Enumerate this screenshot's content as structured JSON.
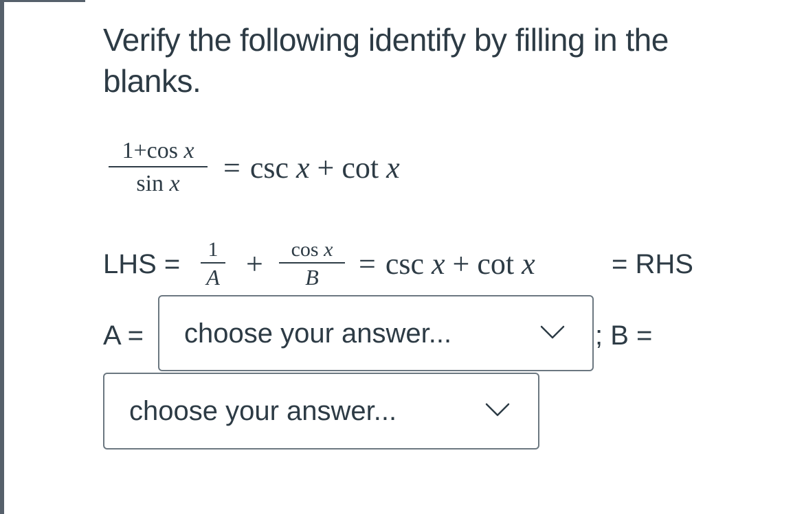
{
  "question": {
    "text": "Verify the following identify by filling in the blanks."
  },
  "identity": {
    "numerator": "1+cos x",
    "denominator": "sin x",
    "equals": "=",
    "rhs": "csc x + cot x"
  },
  "work": {
    "lhs_label": "LHS =",
    "frac1_num": "1",
    "frac1_den": "A",
    "plus": "+",
    "frac2_num": "cos x",
    "frac2_den": "B",
    "equals": "=",
    "middle": "csc x + cot x",
    "rhs_label": "= RHS"
  },
  "answers": {
    "label_a": "A =",
    "select_a_value": "choose your answer...",
    "label_b": "; B =",
    "select_b_value": "choose your answer...",
    "chevron_icon": "chevron-down-icon"
  },
  "colors": {
    "text": "#2d3b45",
    "select_border": "#6b7780",
    "page_border": "#56606b"
  }
}
